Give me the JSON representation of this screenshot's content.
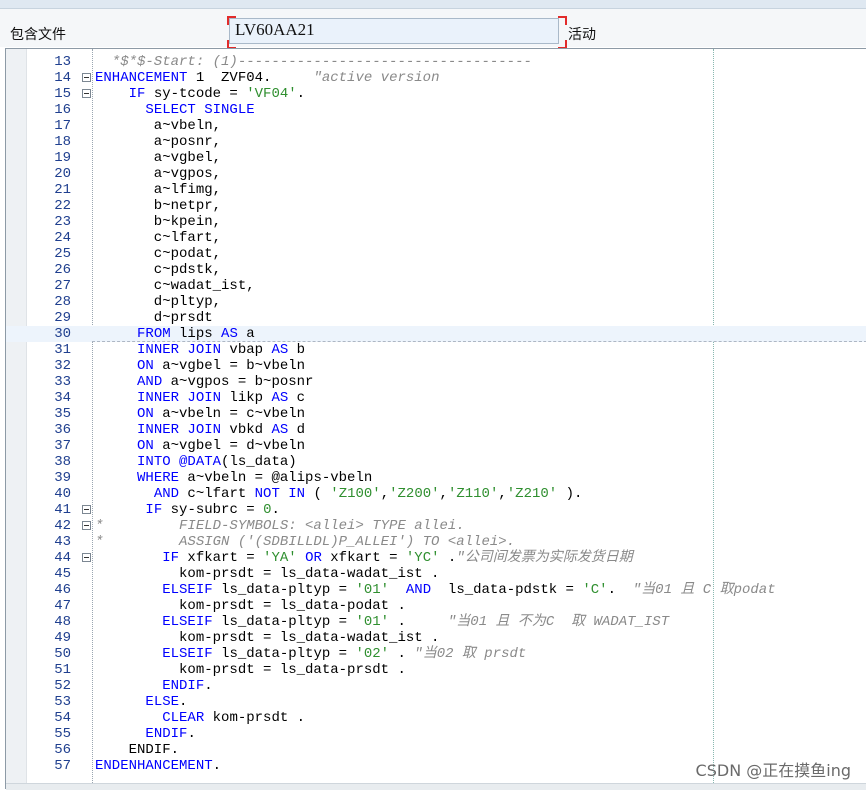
{
  "header": {
    "label": "包含文件",
    "program_name": "LV60AA21",
    "status": "活动"
  },
  "watermark": "CSDN @正在摸鱼ing",
  "lines": [
    {
      "no": "13",
      "fold": false,
      "tokens": [
        {
          "t": "  *$*$-Start: (1)-----------------------------------",
          "c": "cm"
        }
      ]
    },
    {
      "no": "14",
      "fold": true,
      "tokens": [
        {
          "t": "ENHANCEMENT",
          "c": "kw"
        },
        {
          "t": " 1  ZVF04.     ",
          "c": ""
        },
        {
          "t": "\"active version",
          "c": "cm"
        }
      ]
    },
    {
      "no": "15",
      "fold": true,
      "tokens": [
        {
          "t": "    ",
          "c": ""
        },
        {
          "t": "IF",
          "c": "kw"
        },
        {
          "t": " sy-tcode = ",
          "c": ""
        },
        {
          "t": "'VF04'",
          "c": "str"
        },
        {
          "t": ".",
          "c": ""
        }
      ]
    },
    {
      "no": "16",
      "fold": false,
      "tokens": [
        {
          "t": "      ",
          "c": ""
        },
        {
          "t": "SELECT SINGLE",
          "c": "kw"
        }
      ]
    },
    {
      "no": "17",
      "fold": false,
      "tokens": [
        {
          "t": "       a~vbeln,",
          "c": ""
        }
      ]
    },
    {
      "no": "18",
      "fold": false,
      "tokens": [
        {
          "t": "       a~posnr,",
          "c": ""
        }
      ]
    },
    {
      "no": "19",
      "fold": false,
      "tokens": [
        {
          "t": "       a~vgbel,",
          "c": ""
        }
      ]
    },
    {
      "no": "20",
      "fold": false,
      "tokens": [
        {
          "t": "       a~vgpos,",
          "c": ""
        }
      ]
    },
    {
      "no": "21",
      "fold": false,
      "tokens": [
        {
          "t": "       a~lfimg,",
          "c": ""
        }
      ]
    },
    {
      "no": "22",
      "fold": false,
      "tokens": [
        {
          "t": "       b~netpr,",
          "c": ""
        }
      ]
    },
    {
      "no": "23",
      "fold": false,
      "tokens": [
        {
          "t": "       b~kpein,",
          "c": ""
        }
      ]
    },
    {
      "no": "24",
      "fold": false,
      "tokens": [
        {
          "t": "       c~lfart,",
          "c": ""
        }
      ]
    },
    {
      "no": "25",
      "fold": false,
      "tokens": [
        {
          "t": "       c~podat,",
          "c": ""
        }
      ]
    },
    {
      "no": "26",
      "fold": false,
      "tokens": [
        {
          "t": "       c~pdstk,",
          "c": ""
        }
      ]
    },
    {
      "no": "27",
      "fold": false,
      "tokens": [
        {
          "t": "       c~wadat_ist,",
          "c": ""
        }
      ]
    },
    {
      "no": "28",
      "fold": false,
      "tokens": [
        {
          "t": "       d~pltyp,",
          "c": ""
        }
      ]
    },
    {
      "no": "29",
      "fold": false,
      "tokens": [
        {
          "t": "       d~prsdt",
          "c": ""
        }
      ]
    },
    {
      "no": "30",
      "fold": false,
      "hl": true,
      "tokens": [
        {
          "t": "     ",
          "c": ""
        },
        {
          "t": "FROM",
          "c": "kw"
        },
        {
          "t": " lips ",
          "c": ""
        },
        {
          "t": "AS",
          "c": "kw"
        },
        {
          "t": " a",
          "c": ""
        }
      ]
    },
    {
      "no": "31",
      "fold": false,
      "tokens": [
        {
          "t": "     ",
          "c": ""
        },
        {
          "t": "INNER JOIN",
          "c": "kw"
        },
        {
          "t": " vbap ",
          "c": ""
        },
        {
          "t": "AS",
          "c": "kw"
        },
        {
          "t": " b",
          "c": ""
        }
      ]
    },
    {
      "no": "32",
      "fold": false,
      "tokens": [
        {
          "t": "     ",
          "c": ""
        },
        {
          "t": "ON",
          "c": "kw"
        },
        {
          "t": " a~vgbel = b~vbeln",
          "c": ""
        }
      ]
    },
    {
      "no": "33",
      "fold": false,
      "tokens": [
        {
          "t": "     ",
          "c": ""
        },
        {
          "t": "AND",
          "c": "kw"
        },
        {
          "t": " a~vgpos = b~posnr",
          "c": ""
        }
      ]
    },
    {
      "no": "34",
      "fold": false,
      "tokens": [
        {
          "t": "     ",
          "c": ""
        },
        {
          "t": "INNER JOIN",
          "c": "kw"
        },
        {
          "t": " likp ",
          "c": ""
        },
        {
          "t": "AS",
          "c": "kw"
        },
        {
          "t": " c",
          "c": ""
        }
      ]
    },
    {
      "no": "35",
      "fold": false,
      "tokens": [
        {
          "t": "     ",
          "c": ""
        },
        {
          "t": "ON",
          "c": "kw"
        },
        {
          "t": " a~vbeln = c~vbeln",
          "c": ""
        }
      ]
    },
    {
      "no": "36",
      "fold": false,
      "tokens": [
        {
          "t": "     ",
          "c": ""
        },
        {
          "t": "INNER JOIN",
          "c": "kw"
        },
        {
          "t": " vbkd ",
          "c": ""
        },
        {
          "t": "AS",
          "c": "kw"
        },
        {
          "t": " d",
          "c": ""
        }
      ]
    },
    {
      "no": "37",
      "fold": false,
      "tokens": [
        {
          "t": "     ",
          "c": ""
        },
        {
          "t": "ON",
          "c": "kw"
        },
        {
          "t": " a~vgbel = d~vbeln",
          "c": ""
        }
      ]
    },
    {
      "no": "38",
      "fold": false,
      "tokens": [
        {
          "t": "     ",
          "c": ""
        },
        {
          "t": "INTO",
          "c": "kw"
        },
        {
          "t": " ",
          "c": ""
        },
        {
          "t": "@DATA",
          "c": "kw"
        },
        {
          "t": "(ls_data)",
          "c": ""
        }
      ]
    },
    {
      "no": "39",
      "fold": false,
      "tokens": [
        {
          "t": "     ",
          "c": ""
        },
        {
          "t": "WHERE",
          "c": "kw"
        },
        {
          "t": " a~vbeln = @alips-vbeln",
          "c": ""
        }
      ]
    },
    {
      "no": "40",
      "fold": false,
      "tokens": [
        {
          "t": "       ",
          "c": ""
        },
        {
          "t": "AND",
          "c": "kw"
        },
        {
          "t": " c~lfart ",
          "c": ""
        },
        {
          "t": "NOT IN",
          "c": "kw"
        },
        {
          "t": " ( ",
          "c": ""
        },
        {
          "t": "'Z100'",
          "c": "str"
        },
        {
          "t": ",",
          "c": ""
        },
        {
          "t": "'Z200'",
          "c": "str"
        },
        {
          "t": ",",
          "c": ""
        },
        {
          "t": "'Z110'",
          "c": "str"
        },
        {
          "t": ",",
          "c": ""
        },
        {
          "t": "'Z210'",
          "c": "str"
        },
        {
          "t": " ).",
          "c": ""
        }
      ]
    },
    {
      "no": "41",
      "fold": true,
      "tokens": [
        {
          "t": "      ",
          "c": ""
        },
        {
          "t": "IF",
          "c": "kw"
        },
        {
          "t": " sy-subrc = ",
          "c": ""
        },
        {
          "t": "0",
          "c": "num"
        },
        {
          "t": ".",
          "c": ""
        }
      ]
    },
    {
      "no": "42",
      "fold": true,
      "tokens": [
        {
          "t": "*         FIELD-SYMBOLS: <allei> TYPE allei.",
          "c": "cm"
        }
      ]
    },
    {
      "no": "43",
      "fold": false,
      "tokens": [
        {
          "t": "*         ASSIGN ('(SDBILLDL)P_ALLEI') TO <allei>.",
          "c": "cm"
        }
      ]
    },
    {
      "no": "44",
      "fold": true,
      "tokens": [
        {
          "t": "        ",
          "c": ""
        },
        {
          "t": "IF",
          "c": "kw"
        },
        {
          "t": " xfkart = ",
          "c": ""
        },
        {
          "t": "'YA'",
          "c": "str"
        },
        {
          "t": " ",
          "c": ""
        },
        {
          "t": "OR",
          "c": "kw"
        },
        {
          "t": " xfkart = ",
          "c": ""
        },
        {
          "t": "'YC'",
          "c": "str"
        },
        {
          "t": " .",
          "c": ""
        },
        {
          "t": "\"公司间发票为实际发货日期",
          "c": "cm"
        }
      ]
    },
    {
      "no": "45",
      "fold": false,
      "tokens": [
        {
          "t": "          kom-prsdt = ls_data-wadat_ist .",
          "c": ""
        }
      ]
    },
    {
      "no": "46",
      "fold": false,
      "tokens": [
        {
          "t": "        ",
          "c": ""
        },
        {
          "t": "ELSEIF",
          "c": "kw"
        },
        {
          "t": " ls_data-pltyp = ",
          "c": ""
        },
        {
          "t": "'01'",
          "c": "str"
        },
        {
          "t": "  ",
          "c": ""
        },
        {
          "t": "AND",
          "c": "kw"
        },
        {
          "t": "  ls_data-pdstk = ",
          "c": ""
        },
        {
          "t": "'C'",
          "c": "str"
        },
        {
          "t": ".  ",
          "c": ""
        },
        {
          "t": "\"当01 且 C 取podat",
          "c": "cm"
        }
      ]
    },
    {
      "no": "47",
      "fold": false,
      "tokens": [
        {
          "t": "          kom-prsdt = ls_data-podat .",
          "c": ""
        }
      ]
    },
    {
      "no": "48",
      "fold": false,
      "tokens": [
        {
          "t": "        ",
          "c": ""
        },
        {
          "t": "ELSEIF",
          "c": "kw"
        },
        {
          "t": " ls_data-pltyp = ",
          "c": ""
        },
        {
          "t": "'01'",
          "c": "str"
        },
        {
          "t": " .     ",
          "c": ""
        },
        {
          "t": "\"当01 且 不为C  取 WADAT_IST",
          "c": "cm"
        }
      ]
    },
    {
      "no": "49",
      "fold": false,
      "tokens": [
        {
          "t": "          kom-prsdt = ls_data-wadat_ist .",
          "c": ""
        }
      ]
    },
    {
      "no": "50",
      "fold": false,
      "tokens": [
        {
          "t": "        ",
          "c": ""
        },
        {
          "t": "ELSEIF",
          "c": "kw"
        },
        {
          "t": " ls_data-pltyp = ",
          "c": ""
        },
        {
          "t": "'02'",
          "c": "str"
        },
        {
          "t": " . ",
          "c": ""
        },
        {
          "t": "\"当02 取 prsdt",
          "c": "cm"
        }
      ]
    },
    {
      "no": "51",
      "fold": false,
      "tokens": [
        {
          "t": "          kom-prsdt = ls_data-prsdt .",
          "c": ""
        }
      ]
    },
    {
      "no": "52",
      "fold": false,
      "tokens": [
        {
          "t": "        ",
          "c": ""
        },
        {
          "t": "ENDIF",
          "c": "kw"
        },
        {
          "t": ".",
          "c": ""
        }
      ]
    },
    {
      "no": "53",
      "fold": false,
      "tokens": [
        {
          "t": "      ",
          "c": ""
        },
        {
          "t": "ELSE",
          "c": "kw"
        },
        {
          "t": ".",
          "c": ""
        }
      ]
    },
    {
      "no": "54",
      "fold": false,
      "tokens": [
        {
          "t": "        ",
          "c": ""
        },
        {
          "t": "CLEAR",
          "c": "kw"
        },
        {
          "t": " kom-prsdt .",
          "c": ""
        }
      ]
    },
    {
      "no": "55",
      "fold": false,
      "tokens": [
        {
          "t": "      ",
          "c": ""
        },
        {
          "t": "ENDIF",
          "c": "kw"
        },
        {
          "t": ".",
          "c": ""
        }
      ]
    },
    {
      "no": "56",
      "fold": false,
      "tokens": [
        {
          "t": "    ENDIF.",
          "c": ""
        }
      ]
    },
    {
      "no": "57",
      "fold": false,
      "tokens": [
        {
          "t": "ENDENHANCEMENT",
          "c": "kw"
        },
        {
          "t": ".",
          "c": ""
        }
      ]
    }
  ]
}
